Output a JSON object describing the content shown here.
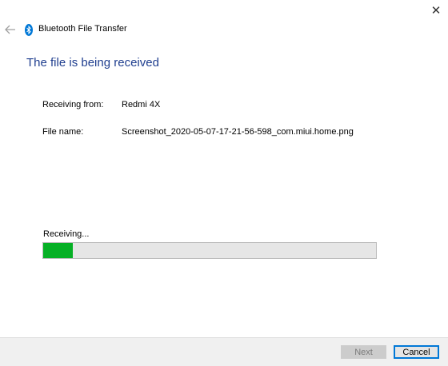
{
  "window": {
    "title": "Bluetooth File Transfer",
    "close_glyph": "✕"
  },
  "main": {
    "heading": "The file is being received",
    "receiving_from_label": "Receiving from:",
    "receiving_from_value": "Redmi 4X",
    "file_name_label": "File name:",
    "file_name_value": "Screenshot_2020-05-07-17-21-56-598_com.miui.home.png"
  },
  "progress": {
    "label": "Receiving...",
    "fraction": 0.09,
    "fill_color": "#06b025"
  },
  "footer": {
    "next_label": "Next",
    "next_enabled": false,
    "cancel_label": "Cancel"
  },
  "icons": {
    "back": "back-arrow-icon",
    "bluetooth": "bluetooth-icon",
    "close": "close-icon"
  },
  "colors": {
    "heading": "#1f3e8f",
    "bluetooth": "#0078d7",
    "accent": "#0078d7"
  }
}
